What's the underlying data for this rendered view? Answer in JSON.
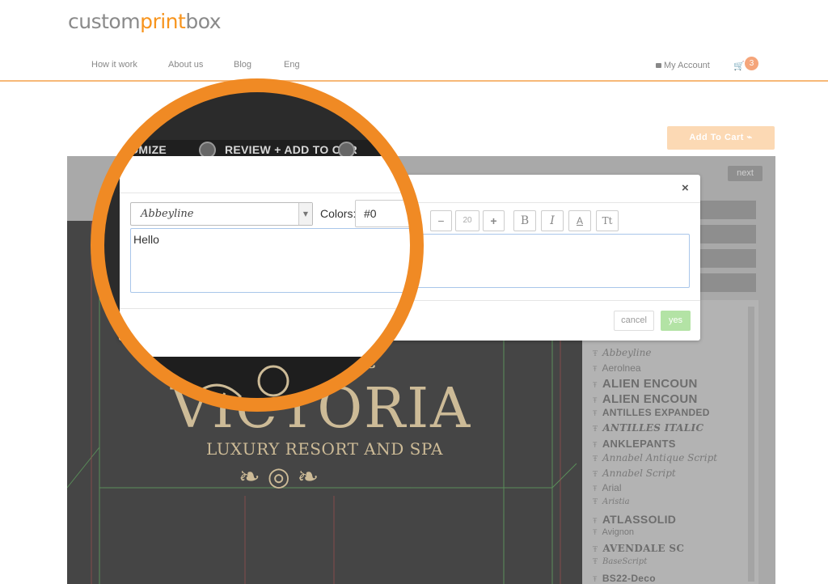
{
  "header": {
    "logo_prefix": "custom",
    "logo_accent": "print",
    "logo_suffix": "box",
    "nav": [
      {
        "label": "How it work"
      },
      {
        "label": "About us"
      },
      {
        "label": "Blog"
      },
      {
        "label": "Eng"
      }
    ],
    "account_label": "My Account",
    "cart_count": "3"
  },
  "toolbar": {
    "add_to_cart_label": "Add To Cart",
    "next_label": "next"
  },
  "steps": {
    "customize": "STOMIZE",
    "review": "REVIEW + ADD TO CAR"
  },
  "modal": {
    "close_label": "×",
    "font_name": "Abbeyline",
    "colors_label": "Colors:",
    "color_value": "#0",
    "font_size": "20",
    "text_value": "Hello",
    "cancel_label": "cancel",
    "yes_label": "yes"
  },
  "artwork": {
    "title": "VICTORIA",
    "subtitle": "LUXURY RESORT AND SPA"
  },
  "fonts": [
    "Abbeyline",
    "Aerolnea",
    "ALIEN ENCOUN",
    "ALIEN ENCOUN",
    "ANTILLES EXPANDED",
    "ANTILLES ITALIC",
    "ANKLEPANTS",
    "Annabel Antique Script",
    "Annabel Script",
    "Arial",
    "Aristia",
    "ATLASSOLID",
    "Avignon",
    "AVENDALE SC",
    "BaseScript",
    "BS22-Deco"
  ],
  "colors": {
    "accent": "#f7941d",
    "lens_ring": "#f08a24",
    "yes_button": "#b3e3a5"
  }
}
